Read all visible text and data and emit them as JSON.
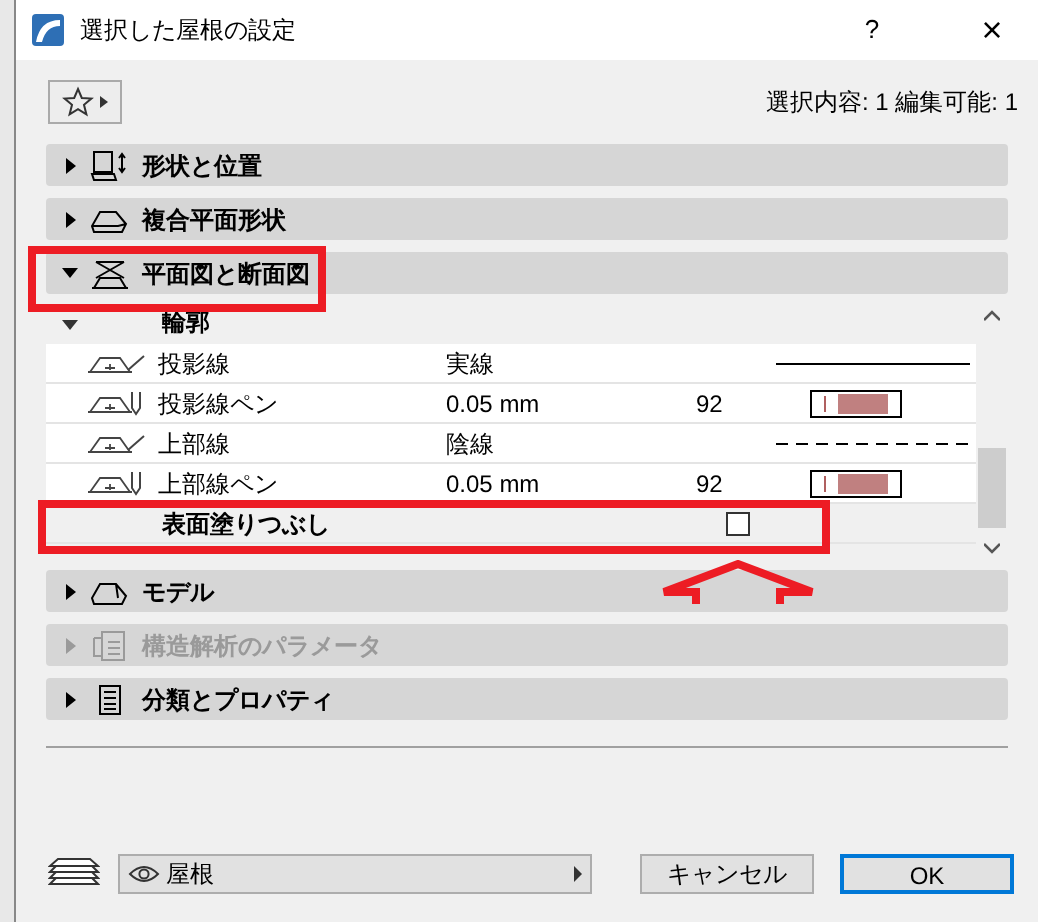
{
  "window": {
    "title": "選択した屋根の設定",
    "help": "?",
    "close": "×"
  },
  "selection_info": "選択内容: 1 編集可能: 1",
  "sections_top": [
    {
      "label": "形状と位置",
      "expanded": false,
      "disabled": false
    },
    {
      "label": "複合平面形状",
      "expanded": false,
      "disabled": false
    },
    {
      "label": "平面図と断面図",
      "expanded": true,
      "disabled": false
    }
  ],
  "subpanel": {
    "group": {
      "label": "輪郭",
      "expanded": true
    },
    "rows": [
      {
        "kind": "line",
        "label": "投影線",
        "value": "実線",
        "dashed": false
      },
      {
        "kind": "pen",
        "label": "投影線ペン",
        "value": "0.05 mm",
        "number": "92",
        "color": "#c08080"
      },
      {
        "kind": "line",
        "label": "上部線",
        "value": "陰線",
        "dashed": true
      },
      {
        "kind": "pen",
        "label": "上部線ペン",
        "value": "0.05 mm",
        "number": "92",
        "color": "#c08080"
      },
      {
        "kind": "check",
        "label": "表面塗りつぶし",
        "checked": false
      }
    ]
  },
  "sections_bottom": [
    {
      "label": "モデル",
      "expanded": false,
      "disabled": false
    },
    {
      "label": "構造解析のパラメータ",
      "expanded": false,
      "disabled": true
    },
    {
      "label": "分類とプロパティ",
      "expanded": false,
      "disabled": false
    }
  ],
  "layer": {
    "value": "屋根"
  },
  "buttons": [
    {
      "label": "キャンセル",
      "default": false
    },
    {
      "label": "OK",
      "default": true
    }
  ]
}
